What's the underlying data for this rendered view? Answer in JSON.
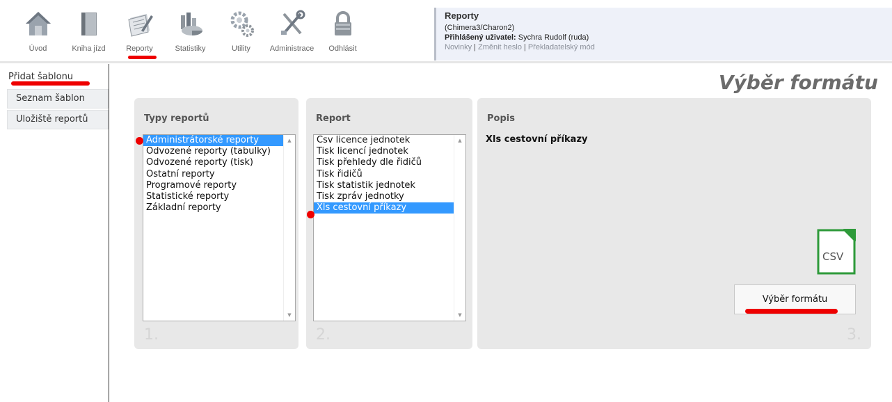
{
  "nav": [
    {
      "label": "Úvod",
      "icon": "home-icon"
    },
    {
      "label": "Kniha jízd",
      "icon": "book-icon"
    },
    {
      "label": "Reporty",
      "icon": "reports-icon"
    },
    {
      "label": "Statistiky",
      "icon": "statistics-icon"
    },
    {
      "label": "Utility",
      "icon": "gears-icon"
    },
    {
      "label": "Administrace",
      "icon": "tools-icon"
    },
    {
      "label": "Odhlásit",
      "icon": "lock-icon"
    }
  ],
  "nav_active": "Reporty",
  "userbox": {
    "title": "Reporty",
    "server": "(Chimera3/Charon2)",
    "user_label": "Přihlášený uživatel:",
    "user_value": "Sychra Rudolf (ruda)",
    "links": [
      "Novinky",
      "Změnit heslo",
      "Překladatelský mód"
    ]
  },
  "sidebar": {
    "items": [
      "Přidat šablonu",
      "Seznam šablon",
      "Uložiště reportů"
    ]
  },
  "page_title": "Výběr formátu",
  "panel1": {
    "heading": "Typy reportů",
    "number": "1.",
    "options": [
      "Administrátorské reporty",
      "Odvozené reporty (tabulky)",
      "Odvozené reporty (tisk)",
      "Ostatní reporty",
      "Programové reporty",
      "Statistické reporty",
      "Základní reporty"
    ],
    "selected_index": 0
  },
  "panel2": {
    "heading": "Report",
    "number": "2.",
    "options": [
      "Csv licence jednotek",
      "Tisk licencí jednotek",
      "Tisk přehledy dle řidičů",
      "Tisk řidičů",
      "Tisk statistik jednotek",
      "Tisk zpráv jednotky",
      "Xls cestovní příkazy"
    ],
    "selected_index": 6
  },
  "panel3": {
    "heading": "Popis",
    "number": "3.",
    "description": "Xls cestovní příkazy",
    "file_icon_label": "CSV",
    "button_label": "Výběr formátu"
  },
  "colors": {
    "selection": "#3399ff",
    "annotation": "#ee0000",
    "panel_bg": "#e8e8e8"
  }
}
